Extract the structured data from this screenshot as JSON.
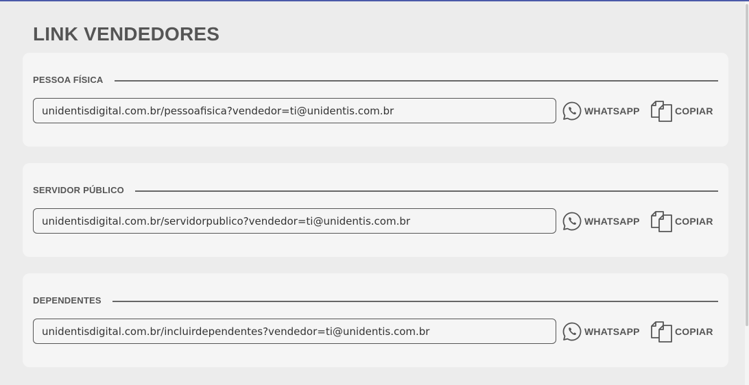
{
  "page": {
    "title": "LINK VENDEDORES"
  },
  "sections": [
    {
      "label": "PESSOA FÍSICA",
      "link": "unidentisdigital.com.br/pessoafisica?vendedor=ti@unidentis.com.br",
      "whatsapp_label": "WHATSAPP",
      "copy_label": "COPIAR"
    },
    {
      "label": "SERVIDOR PÚBLICO",
      "link": "unidentisdigital.com.br/servidorpublico?vendedor=ti@unidentis.com.br",
      "whatsapp_label": "WHATSAPP",
      "copy_label": "COPIAR"
    },
    {
      "label": "DEPENDENTES",
      "link": "unidentisdigital.com.br/incluirdependentes?vendedor=ti@unidentis.com.br",
      "whatsapp_label": "WHATSAPP",
      "copy_label": "COPIAR"
    }
  ],
  "icons": {
    "whatsapp": "whatsapp-icon",
    "copy": "copy-icon"
  },
  "colors": {
    "accent_top_border": "#4a59a8",
    "text": "#555555",
    "card_bg": "#f5f5f5",
    "page_bg": "#ececec"
  }
}
